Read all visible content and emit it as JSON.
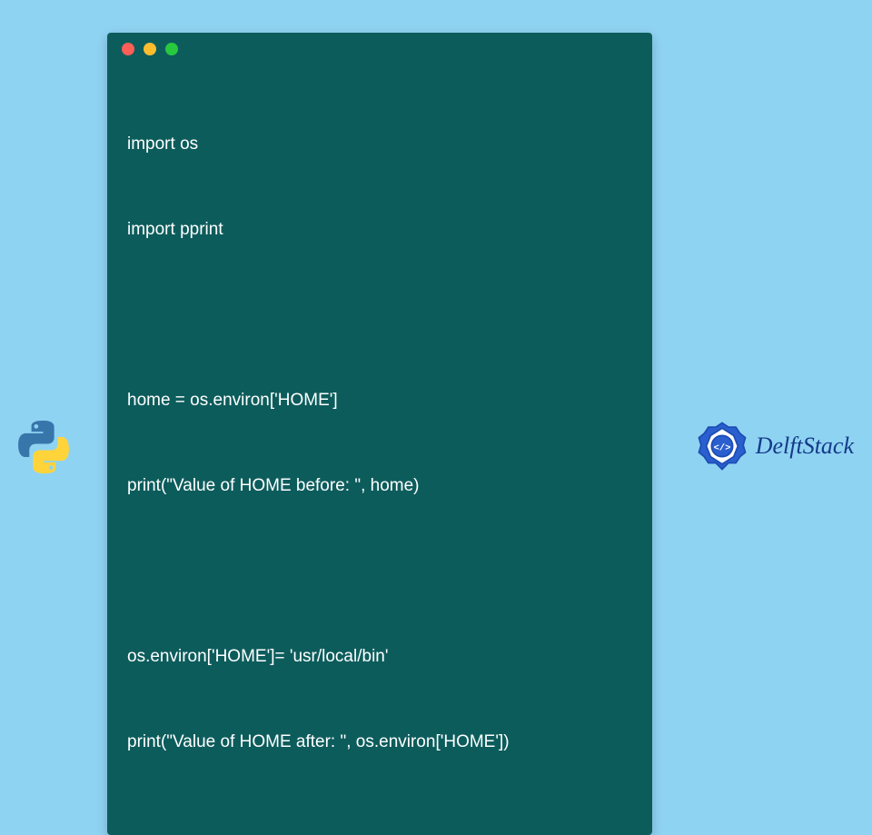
{
  "code": {
    "lines": [
      "import os",
      "import pprint",
      "",
      "home = os.environ['HOME']",
      "print(\"Value of HOME before: \", home)",
      "",
      "os.environ['HOME']= 'usr/local/bin'",
      "print(\"Value of HOME after: \", os.environ['HOME'])"
    ]
  },
  "brand": {
    "name": "DelftStack"
  },
  "colors": {
    "page_bg": "#8fd3f2",
    "window_bg": "#0d5c5c",
    "code_text": "#ffffff",
    "brand_text": "#143a8a",
    "dot_red": "#ff5f56",
    "dot_yellow": "#ffbd2e",
    "dot_green": "#27c93f"
  }
}
